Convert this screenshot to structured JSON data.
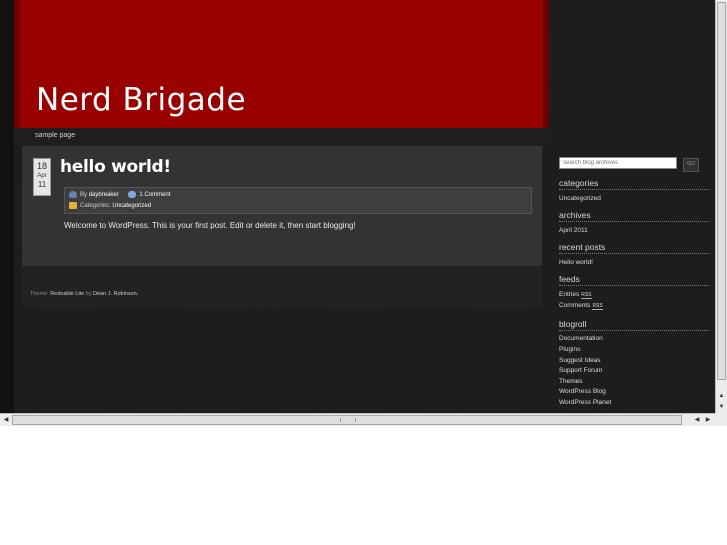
{
  "site": {
    "title": "Nerd Brigade"
  },
  "nav": {
    "items": [
      {
        "label": "sample page"
      }
    ]
  },
  "post": {
    "date": {
      "day": "18",
      "month": "Apr",
      "year": "11"
    },
    "title": "hello world!",
    "meta": {
      "by_label": "By",
      "author": "daybreaker",
      "comments": "1 Comment",
      "categories_label": "Categories:",
      "category": "Uncategorized"
    },
    "body": "Welcome to WordPress. This is your first post. Edit or delete it, then start blogging!"
  },
  "footer": {
    "theme_label": "Theme:",
    "theme_name": "Redoable Lite",
    "by_label": "by",
    "author": "Dean J. Robinson."
  },
  "sidebar": {
    "search": {
      "placeholder": "search blog archives",
      "button_label": "GO"
    },
    "categories": {
      "heading": "categories",
      "items": [
        "Uncategorized"
      ]
    },
    "archives": {
      "heading": "archives",
      "items": [
        "April 2011"
      ]
    },
    "recent_posts": {
      "heading": "recent posts",
      "items": [
        "Hello world!"
      ]
    },
    "feeds": {
      "heading": "feeds",
      "items": [
        {
          "label": "Entries",
          "badge": "RSS"
        },
        {
          "label": "Comments",
          "badge": "RSS"
        }
      ]
    },
    "blogroll": {
      "heading": "blogroll",
      "items": [
        "Documentation",
        "Plugins",
        "Suggest Ideas",
        "Support Forum",
        "Themes",
        "WordPress Blog",
        "WordPress Planet"
      ]
    }
  },
  "scrollbar": {
    "up": "▲",
    "down": "▼",
    "left": "◀",
    "right": "▶"
  },
  "colors": {
    "header": "#990000",
    "background": "#1a1a1a",
    "content": "#333333"
  }
}
